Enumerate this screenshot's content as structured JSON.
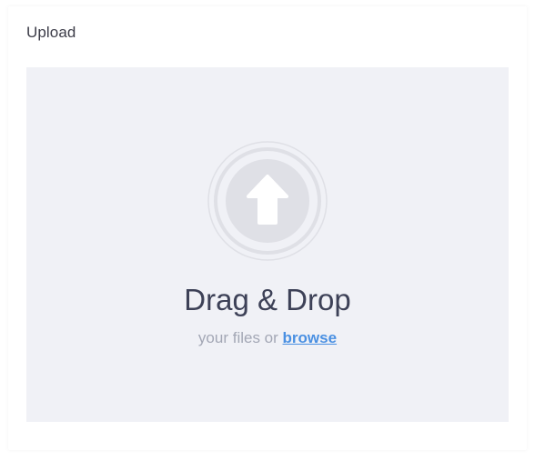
{
  "panel": {
    "title": "Upload"
  },
  "dropzone": {
    "icon": "upload-arrow-icon",
    "title": "Drag & Drop",
    "subtitle_prefix": "your files or",
    "browse_label": "browse"
  },
  "colors": {
    "dropzone_bg": "#f0f1f6",
    "title_text": "#3d4157",
    "subtitle_text": "#a3a7b5",
    "link": "#4a90e2",
    "icon_fill": "#dfe0e6"
  }
}
